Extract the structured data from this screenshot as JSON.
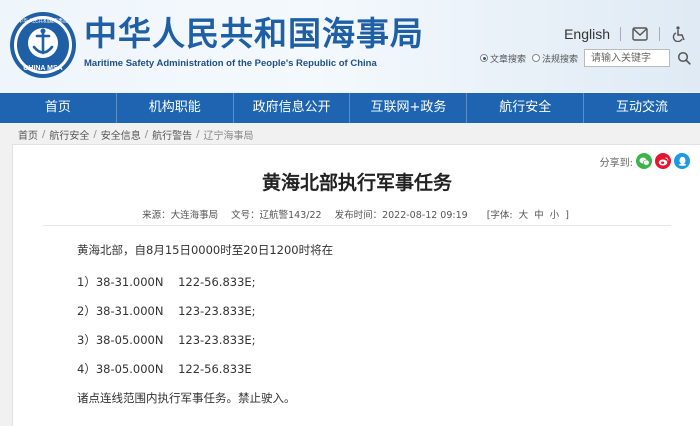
{
  "header": {
    "logo_text": "CHINA MSA",
    "logo_top_text": "中华人民共和国海事局",
    "title": "中华人民共和国海事局",
    "subtitle": "Maritime Safety Administration of the People's Republic of China",
    "lang_link": "English",
    "search": {
      "option_1": "文章搜索",
      "option_2": "法规搜索",
      "selected": "option_1",
      "placeholder": "请输入关键字"
    }
  },
  "nav": {
    "items": [
      "首页",
      "机构职能",
      "政府信息公开",
      "互联网+政务",
      "航行安全",
      "互动交流"
    ]
  },
  "breadcrumb": {
    "items": [
      "首页",
      "航行安全",
      "安全信息",
      "航行警告",
      "辽宁海事局"
    ],
    "separator": "/"
  },
  "article": {
    "share_label": "分享到:",
    "title": "黄海北部执行军事任务",
    "meta": {
      "source": "来源：大连海事局",
      "doc_no": "文号：辽航警143/22",
      "publish_time": "发布时间：2022-08-12 09:19",
      "font_label": "[字体:",
      "font_large": "大",
      "font_medium": "中",
      "font_small": "小",
      "font_close": "]"
    },
    "paragraphs": [
      "黄海北部，自8月15日0000时至20日1200时将在",
      "1）38-31.000N    122-56.833E;",
      "2）38-31.000N    123-23.833E;",
      "3）38-05.000N    123-23.833E;",
      "4）38-05.000N    122-56.833E",
      "诸点连线范围内执行军事任务。禁止驶入。"
    ]
  },
  "colors": {
    "brand_blue": "#1e64b0",
    "title_blue": "#1f5fa6",
    "wechat_green": "#3bb54a",
    "weibo_red": "#e6162d",
    "qq_blue": "#1c9be2"
  }
}
